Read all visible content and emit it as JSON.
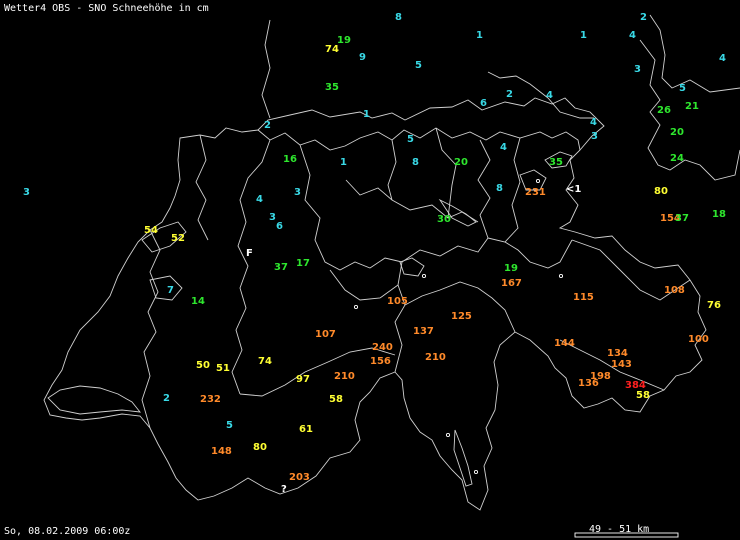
{
  "header": {
    "title": "Wetter4 OBS - SNO Schneehöhe in cm"
  },
  "footer": {
    "timestamp": "So, 08.02.2009 06:00z",
    "scale_label": "49 - 51 km"
  },
  "colors": {
    "background": "#000000",
    "borders": "#d0d0d0",
    "very_low": "#39d9e6",
    "low": "#2ee62e",
    "medium": "#ffff33",
    "high": "#ff8a2a",
    "very_high": "#ff2020",
    "marker": "#ffffff"
  },
  "legend_note": "value color scales with snow depth",
  "stations": [
    {
      "label": "8",
      "color": "very_low"
    },
    {
      "label": "1",
      "color": "very_low"
    },
    {
      "label": "1",
      "color": "very_low"
    },
    {
      "label": "4",
      "color": "very_low"
    },
    {
      "label": "2",
      "color": "very_low"
    },
    {
      "label": "19",
      "color": "low"
    },
    {
      "label": "74",
      "color": "medium"
    },
    {
      "label": "9",
      "color": "very_low"
    },
    {
      "label": "5",
      "color": "very_low"
    },
    {
      "label": "3",
      "color": "very_low"
    },
    {
      "label": "4",
      "color": "very_low"
    },
    {
      "label": "35",
      "color": "low"
    },
    {
      "label": "5",
      "color": "very_low"
    },
    {
      "label": "6",
      "color": "very_low"
    },
    {
      "label": "2",
      "color": "very_low"
    },
    {
      "label": "4",
      "color": "very_low"
    },
    {
      "label": "26",
      "color": "low"
    },
    {
      "label": "21",
      "color": "low"
    },
    {
      "label": "1",
      "color": "very_low"
    },
    {
      "label": "2",
      "color": "very_low"
    },
    {
      "label": "4",
      "color": "very_low"
    },
    {
      "label": "3",
      "color": "very_low"
    },
    {
      "label": "20",
      "color": "low"
    },
    {
      "label": "5",
      "color": "very_low"
    },
    {
      "label": "4",
      "color": "very_low"
    },
    {
      "label": "16",
      "color": "low"
    },
    {
      "label": "1",
      "color": "very_low"
    },
    {
      "label": "8",
      "color": "very_low"
    },
    {
      "label": "20",
      "color": "low"
    },
    {
      "label": "35",
      "color": "low"
    },
    {
      "label": "24",
      "color": "low"
    },
    {
      "label": "3",
      "color": "very_low"
    },
    {
      "label": "3",
      "color": "very_low"
    },
    {
      "label": "8",
      "color": "very_low"
    },
    {
      "label": "231",
      "color": "high"
    },
    {
      "label": "<1",
      "color": "marker"
    },
    {
      "label": "80",
      "color": "medium"
    },
    {
      "label": "4",
      "color": "very_low"
    },
    {
      "label": "3",
      "color": "very_low"
    },
    {
      "label": "6",
      "color": "very_low"
    },
    {
      "label": "30",
      "color": "low"
    },
    {
      "label": "154",
      "color": "high"
    },
    {
      "label": "37",
      "color": "low"
    },
    {
      "label": "18",
      "color": "low"
    },
    {
      "label": "54",
      "color": "medium"
    },
    {
      "label": "52",
      "color": "medium"
    },
    {
      "label": "F",
      "color": "marker"
    },
    {
      "label": "37",
      "color": "low"
    },
    {
      "label": "17",
      "color": "low"
    },
    {
      "label": "19",
      "color": "low"
    },
    {
      "label": "167",
      "color": "high"
    },
    {
      "label": "7",
      "color": "very_low"
    },
    {
      "label": "14",
      "color": "low"
    },
    {
      "label": "105",
      "color": "high"
    },
    {
      "label": "115",
      "color": "high"
    },
    {
      "label": "108",
      "color": "high"
    },
    {
      "label": "76",
      "color": "medium"
    },
    {
      "label": "125",
      "color": "high"
    },
    {
      "label": "107",
      "color": "high"
    },
    {
      "label": "137",
      "color": "high"
    },
    {
      "label": "240",
      "color": "high"
    },
    {
      "label": "144",
      "color": "high"
    },
    {
      "label": "100",
      "color": "high"
    },
    {
      "label": "210",
      "color": "high"
    },
    {
      "label": "156",
      "color": "high"
    },
    {
      "label": "134",
      "color": "high"
    },
    {
      "label": "50",
      "color": "medium"
    },
    {
      "label": "51",
      "color": "medium"
    },
    {
      "label": "74",
      "color": "medium"
    },
    {
      "label": "143",
      "color": "high"
    },
    {
      "label": "210",
      "color": "high"
    },
    {
      "label": "97",
      "color": "medium"
    },
    {
      "label": "198",
      "color": "high"
    },
    {
      "label": "136",
      "color": "high"
    },
    {
      "label": "384",
      "color": "very_high"
    },
    {
      "label": "2",
      "color": "very_low"
    },
    {
      "label": "232",
      "color": "high"
    },
    {
      "label": "58",
      "color": "medium"
    },
    {
      "label": "58",
      "color": "medium"
    },
    {
      "label": "5",
      "color": "very_low"
    },
    {
      "label": "61",
      "color": "medium"
    },
    {
      "label": "148",
      "color": "high"
    },
    {
      "label": "80",
      "color": "medium"
    },
    {
      "label": "203",
      "color": "high"
    },
    {
      "label": "?",
      "color": "marker"
    }
  ]
}
